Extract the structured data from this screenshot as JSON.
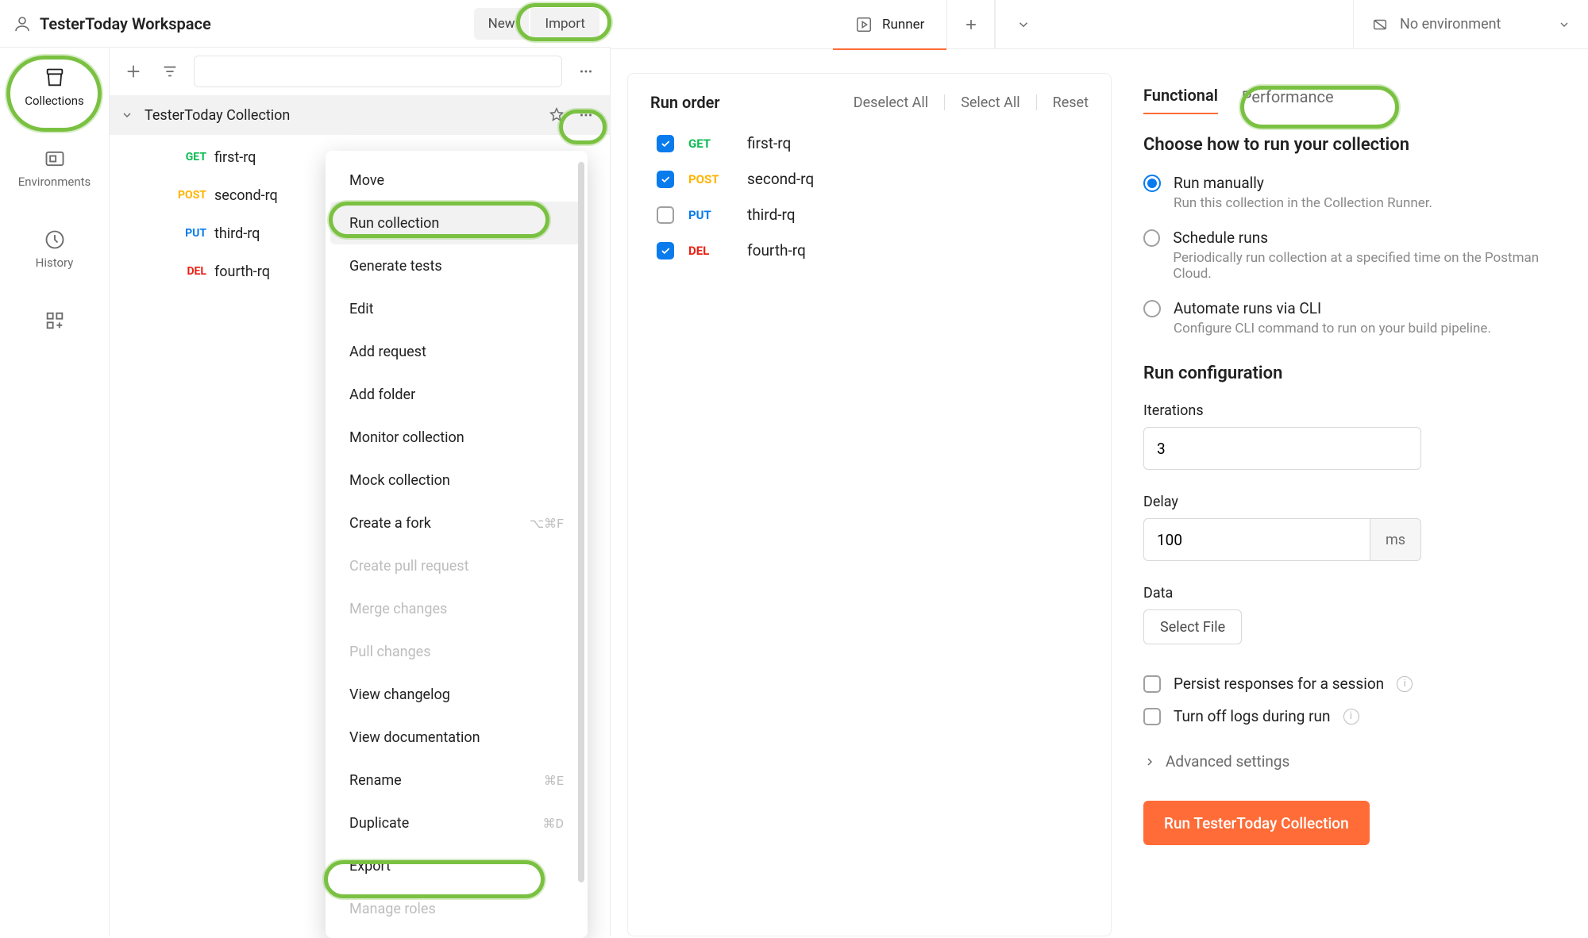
{
  "header": {
    "workspace": "TesterToday Workspace",
    "new": "New",
    "import": "Import"
  },
  "rail": {
    "collections": "Collections",
    "environments": "Environments",
    "history": "History"
  },
  "collection": {
    "name": "TesterToday Collection",
    "requests": [
      {
        "method": "GET",
        "methodClass": "m-get",
        "name": "first-rq"
      },
      {
        "method": "POST",
        "methodClass": "m-post",
        "name": "second-rq"
      },
      {
        "method": "PUT",
        "methodClass": "m-put",
        "name": "third-rq"
      },
      {
        "method": "DEL",
        "methodClass": "m-del",
        "name": "fourth-rq"
      }
    ]
  },
  "ctx": {
    "move": "Move",
    "run": "Run collection",
    "gentests": "Generate tests",
    "edit": "Edit",
    "addreq": "Add request",
    "addfolder": "Add folder",
    "monitor": "Monitor collection",
    "mock": "Mock collection",
    "fork": "Create a fork",
    "fork_sc": "⌥⌘F",
    "pr": "Create pull request",
    "merge": "Merge changes",
    "pull": "Pull changes",
    "changelog": "View changelog",
    "docs": "View documentation",
    "rename": "Rename",
    "rename_sc": "⌘E",
    "dup": "Duplicate",
    "dup_sc": "⌘D",
    "export": "Export",
    "roles": "Manage roles"
  },
  "tabs": {
    "runner": "Runner",
    "env": "No environment"
  },
  "runorder": {
    "title": "Run order",
    "deselect": "Deselect All",
    "select": "Select All",
    "reset": "Reset",
    "items": [
      {
        "method": "GET",
        "methodClass": "m-get",
        "name": "first-rq",
        "checked": true
      },
      {
        "method": "POST",
        "methodClass": "m-post",
        "name": "second-rq",
        "checked": true
      },
      {
        "method": "PUT",
        "methodClass": "m-put",
        "name": "third-rq",
        "checked": false
      },
      {
        "method": "DEL",
        "methodClass": "m-del",
        "name": "fourth-rq",
        "checked": true
      }
    ]
  },
  "runcfg": {
    "seg_func": "Functional",
    "seg_perf": "Performance",
    "choose_title": "Choose how to run your collection",
    "opts": [
      {
        "title": "Run manually",
        "desc": "Run this collection in the Collection Runner.",
        "sel": true
      },
      {
        "title": "Schedule runs",
        "desc": "Periodically run collection at a specified time on the Postman Cloud.",
        "sel": false
      },
      {
        "title": "Automate runs via CLI",
        "desc": "Configure CLI command to run on your build pipeline.",
        "sel": false
      }
    ],
    "cfg_title": "Run configuration",
    "iter_lbl": "Iterations",
    "iter_val": "3",
    "delay_lbl": "Delay",
    "delay_val": "100",
    "delay_unit": "ms",
    "data_lbl": "Data",
    "select_file": "Select File",
    "persist": "Persist responses for a session",
    "turnoff": "Turn off logs during run",
    "advanced": "Advanced settings",
    "runbtn": "Run TesterToday Collection"
  }
}
